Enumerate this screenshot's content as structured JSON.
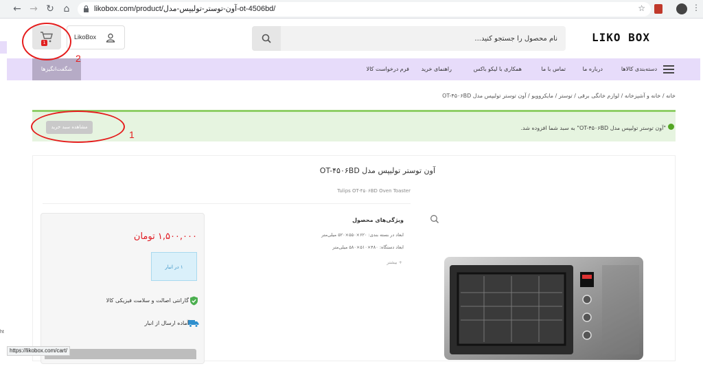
{
  "browser": {
    "url": "likobox.com/product/آون-توستر-تولیپس-مدل-ot-4506bd/",
    "status_url": "https://likobox.com/cart/",
    "left_clip_text": "ht"
  },
  "header": {
    "logo": "LIKO BOX",
    "search_placeholder": "نام محصول را جستجو کنید...",
    "account_label": "LikoBox",
    "cart_count": "1"
  },
  "nav": {
    "categories": "دسته‌بندی کالاها",
    "items": [
      "درباره ما",
      "تماس با ما",
      "همکاری با لیکو باکس",
      "راهنمای خرید",
      "فرم درخواست کالا"
    ],
    "amazing": "شگفت‌انگیزها"
  },
  "breadcrumb": "خانه / خانه و آشپزخانه / لوازم خانگی برقی / توستر / مایکروویو / آون توستر تولیپس مدل OT-۴۵۰۶BD",
  "notice": {
    "text": "\"آون توستر تولیپس مدل OT-۴۵۰۶BD\" به سبد شما افزوده شد.",
    "button": "مشاهده سبد خرید"
  },
  "product": {
    "title": "آون توستر تولیپس مدل OT-۴۵۰۶BD",
    "title_en": "Tulips OT-۴۵۰۶BD Oven Toaster",
    "features_title": "ویژگی‌های محصول",
    "features": [
      "ابعاد در بسته بندی: ۶۲۰×۵۵۰×۵۲۰ میلی‌متر",
      "ابعاد دستگاه: ۴۸۰×۵۱۰×۵۸۰ میلی‌متر"
    ],
    "more": "+ بیشتر",
    "price": "۱,۵۰۰,۰۰۰ تومان",
    "stock": "۱ در انبار",
    "guarantee": "گارانتی اصالت و سلامت فیزیکی کالا",
    "shipping": "آماده ارسال از انبار"
  },
  "annotations": [
    "1",
    "2"
  ],
  "colors": {
    "nav_bg": "#e7dcfa",
    "price": "#e01a22",
    "notice_bg": "#e6f4e0",
    "annotation": "#e51c1c"
  }
}
